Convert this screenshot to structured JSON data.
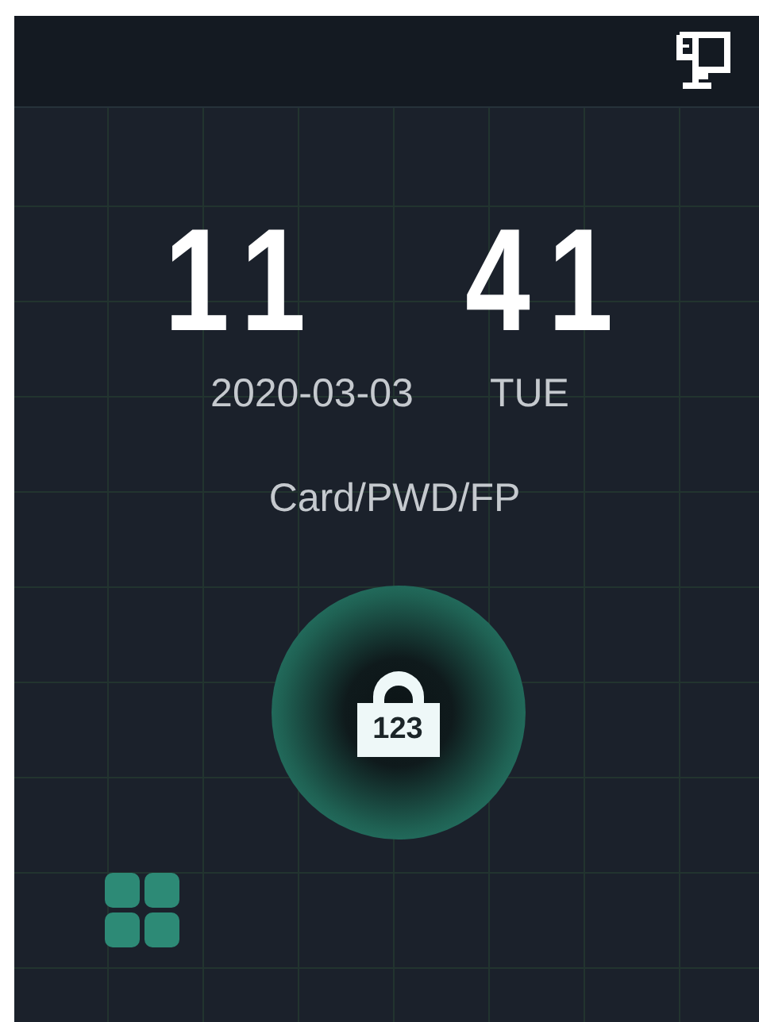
{
  "clock": {
    "hours": "11",
    "minutes": "41"
  },
  "date": "2020-03-03",
  "weekday": "TUE",
  "verify_mode": "Card/PWD/FP",
  "unlock_button": {
    "label": "123"
  }
}
